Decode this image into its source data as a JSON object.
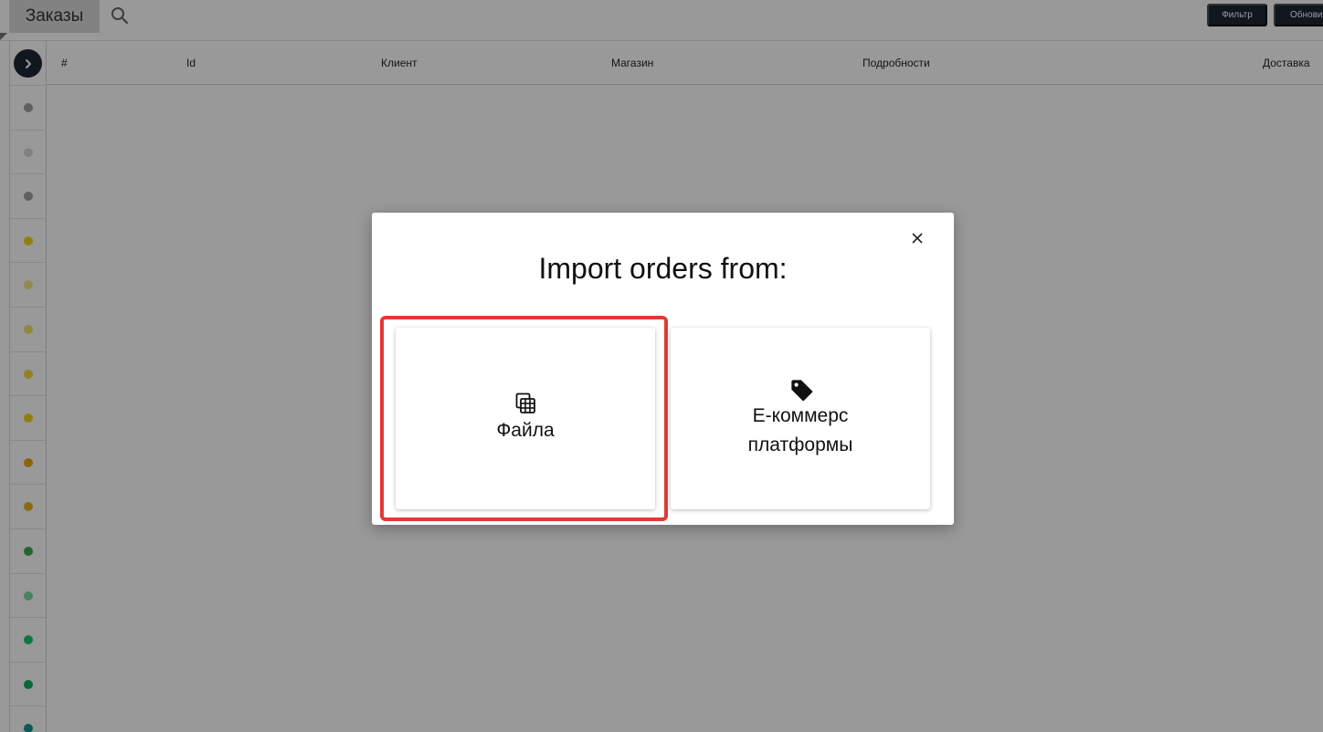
{
  "header": {
    "title": "Заказы",
    "filter_label": "Фильтр",
    "refresh_label": "Обновить"
  },
  "table": {
    "columns": [
      "#",
      "Id",
      "Клиент",
      "Магазин",
      "Подробности",
      "Доставка"
    ]
  },
  "sidebar": {
    "status_colors": [
      "#9e9e9e",
      "#d9d9d9",
      "#9e9e9e",
      "#f2d31b",
      "#f5e58a",
      "#f2e06a",
      "#f2d640",
      "#f2d31b",
      "#e6a81a",
      "#e0b520",
      "#3fa845",
      "#7ddba0",
      "#1ec46b",
      "#15a85a",
      "#14958a"
    ]
  },
  "modal": {
    "title": "Import orders from:",
    "options": [
      {
        "label": "Файла",
        "icon": "spreadsheet-icon"
      },
      {
        "label": "E-коммерс платформы",
        "icon": "tag-icon"
      }
    ]
  },
  "colors": {
    "dark_button": "#1f2633",
    "highlight": "#e03a32"
  }
}
